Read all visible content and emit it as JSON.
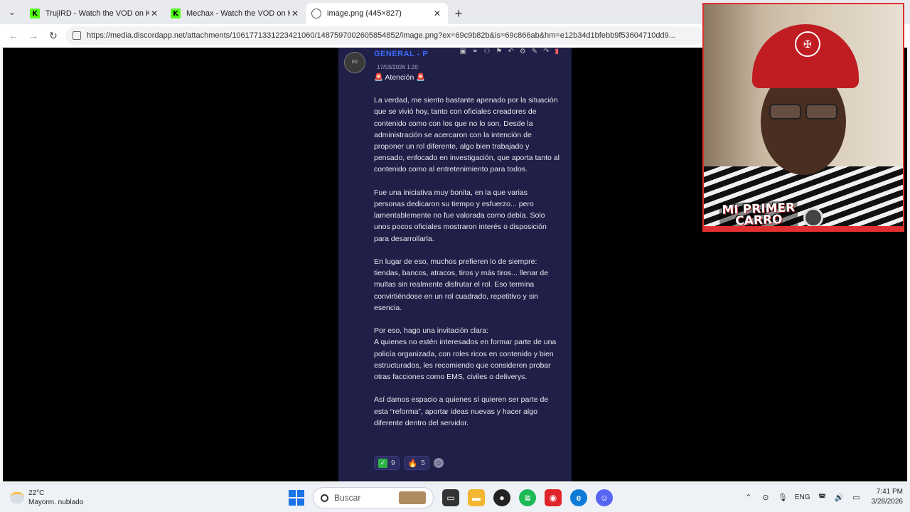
{
  "browser": {
    "tabs": [
      {
        "title": "TrujiRD - Watch the VOD on Kick",
        "active": false
      },
      {
        "title": "Mechax - Watch the VOD on Kick",
        "active": false
      },
      {
        "title": "image.png (445×827)",
        "active": true
      }
    ],
    "url": "https://media.discordapp.net/attachments/1061771331223421060/1487597002605854852/image.png?ex=69c9b82b&is=69c866ab&hm=e12b34d1bfebb9f53604710dd9..."
  },
  "discord": {
    "author": "GENERAL - P",
    "timestamp": "17/03/2026 1:20",
    "heading": "Atención",
    "siren": "🚨",
    "paragraphs": [
      "La verdad, me siento bastante apenado por la situación que se vivió hoy, tanto con oficiales creadores de contenido como con los que no lo son. Desde la administración se acercaron con la intención de proponer un rol diferente, algo bien trabajado y pensado, enfocado en investigación, que aporta tanto al contenido como al entretenimiento para todos.",
      "Fue una iniciativa muy bonita, en la que varias personas dedicaron su tiempo y esfuerzo... pero lamentablemente no fue valorada como debía. Solo unos pocos oficiales mostraron interés o disposición para desarrollarla.",
      "En lugar de eso, muchos prefieren lo de siempre: tiendas, bancos, atracos, tiros y más tiros... llenar de multas sin realmente disfrutar el rol. Eso termina convirtiéndose en un rol cuadrado, repetitivo y sin esencia.",
      "Por eso, hago una invitación clara:\nA quienes no estén interesados en formar parte de una policía organizada, con roles ricos en contenido y bien estructurados, les recomiendo que consideren probar otras facciones como EMS, civiles o deliverys.",
      "Así damos espacio a quienes sí quieren ser parte de esta “reforma”, aportar ideas nuevas y hacer algo diferente dentro del servidor."
    ],
    "reactions": [
      {
        "emoji": "✓",
        "count": "9"
      },
      {
        "emoji": "🔥",
        "count": "5"
      }
    ]
  },
  "webcam": {
    "banner": "MI PRIMER CARRO"
  },
  "taskbar": {
    "temperature": "22°C",
    "weather": "Mayorm. nublado",
    "search_placeholder": "Buscar",
    "language": "ENG",
    "time": "7:41 PM",
    "date": "3/28/2026"
  },
  "colors": {
    "discord_bg": "#1f1f48",
    "author": "#3f6bff",
    "webcam_border": "#e03030"
  }
}
